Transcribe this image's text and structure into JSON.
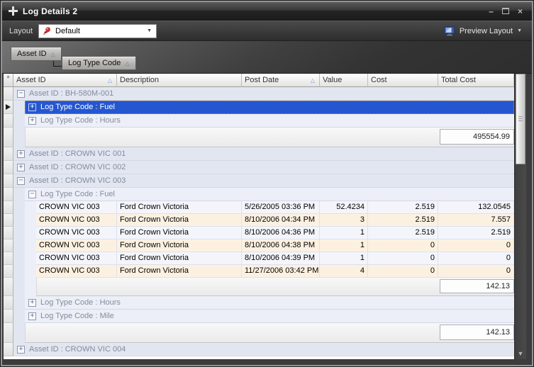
{
  "window": {
    "title": "Log Details 2",
    "minimize_glyph": "–",
    "close_glyph": "×"
  },
  "toolbar": {
    "layout_label": "Layout",
    "layout_value": "Default",
    "preview_label": "Preview Layout",
    "dropdown_glyph": "▼"
  },
  "group_panel": {
    "buttons": [
      {
        "label": "Asset ID"
      },
      {
        "label": "Log Type Code"
      }
    ],
    "sort_glyph": "△"
  },
  "grid": {
    "gutter_header_glyph": "*",
    "columns": [
      {
        "label": "Asset ID",
        "sorted": true
      },
      {
        "label": "Description",
        "sorted": false
      },
      {
        "label": "Post Date",
        "sorted": true
      },
      {
        "label": "Value",
        "sorted": false
      },
      {
        "label": "Cost",
        "sorted": false
      },
      {
        "label": "Total Cost",
        "sorted": false
      }
    ],
    "rows": [
      {
        "type": "group",
        "level": 0,
        "state": "expanded",
        "label": "Asset ID : BH-580M-001"
      },
      {
        "type": "group",
        "level": 1,
        "state": "collapsed",
        "label": "Log Type Code : Fuel",
        "selected": true
      },
      {
        "type": "group",
        "level": 1,
        "state": "collapsed",
        "label": "Log Type Code : Hours"
      },
      {
        "type": "footer",
        "indent": 1,
        "total": "495554.99"
      },
      {
        "type": "group",
        "level": 0,
        "state": "collapsed",
        "label": "Asset ID : CROWN VIC 001"
      },
      {
        "type": "group",
        "level": 0,
        "state": "collapsed",
        "label": "Asset ID : CROWN VIC 002"
      },
      {
        "type": "group",
        "level": 0,
        "state": "expanded",
        "label": "Asset ID : CROWN VIC 003"
      },
      {
        "type": "group",
        "level": 1,
        "state": "expanded",
        "label": "Log Type Code : Fuel"
      },
      {
        "type": "data",
        "cells": [
          "CROWN VIC 003",
          "Ford Crown Victoria",
          "5/26/2005 03:36 PM",
          "52.4234",
          "2.519",
          "132.0545"
        ]
      },
      {
        "type": "data",
        "cells": [
          "CROWN VIC 003",
          "Ford Crown Victoria",
          "8/10/2006 04:34 PM",
          "3",
          "2.519",
          "7.557"
        ]
      },
      {
        "type": "data",
        "cells": [
          "CROWN VIC 003",
          "Ford Crown Victoria",
          "8/10/2006 04:36 PM",
          "1",
          "2.519",
          "2.519"
        ]
      },
      {
        "type": "data",
        "cells": [
          "CROWN VIC 003",
          "Ford Crown Victoria",
          "8/10/2006 04:38 PM",
          "1",
          "0",
          "0"
        ]
      },
      {
        "type": "data",
        "cells": [
          "CROWN VIC 003",
          "Ford Crown Victoria",
          "8/10/2006 04:39 PM",
          "1",
          "0",
          "0"
        ]
      },
      {
        "type": "data",
        "cells": [
          "CROWN VIC 003",
          "Ford Crown Victoria",
          "11/27/2006 03:42 PM",
          "4",
          "0",
          "0"
        ]
      },
      {
        "type": "footer",
        "indent": 2,
        "total": "142.13"
      },
      {
        "type": "group",
        "level": 1,
        "state": "collapsed",
        "label": "Log Type Code : Hours"
      },
      {
        "type": "group",
        "level": 1,
        "state": "collapsed",
        "label": "Log Type Code : Mile"
      },
      {
        "type": "footer",
        "indent": 1,
        "total": "142.13"
      },
      {
        "type": "group",
        "level": 0,
        "state": "collapsed",
        "label": "Asset ID : CROWN VIC 004"
      }
    ]
  },
  "scrollbar": {
    "down_glyph": "▼"
  },
  "colors": {
    "panel_dark": "#3c3c3c",
    "selection_bg": "#2456d0",
    "selection_text": "#ffffff",
    "group_bg": "#e2e6f1",
    "subgroup_bg": "#eceff7",
    "row_alt_blue": "#f3f5fb",
    "row_alt_peach": "#fcf1e1",
    "pin_red": "#c62f2f",
    "monitor_blue": "#3b5fae"
  }
}
